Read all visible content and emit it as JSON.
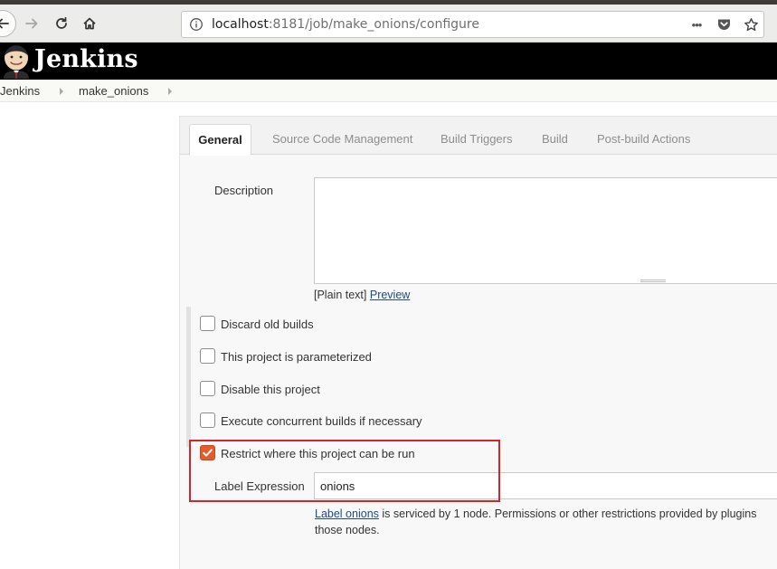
{
  "browser": {
    "url_host": "localhost",
    "url_rest": ":8181/job/make_onions/configure",
    "more_label": "•••"
  },
  "header": {
    "title": "Jenkins"
  },
  "breadcrumb": {
    "items": [
      "Jenkins",
      "make_onions"
    ]
  },
  "tabs": [
    {
      "label": "General",
      "active": true
    },
    {
      "label": "Source Code Management"
    },
    {
      "label": "Build Triggers"
    },
    {
      "label": "Build"
    },
    {
      "label": "Post-build Actions"
    }
  ],
  "description": {
    "label": "Description",
    "value": "",
    "format_note": "[Plain text]",
    "preview_link": "Preview"
  },
  "options": [
    {
      "label": "Discard old builds",
      "checked": false
    },
    {
      "label": "This project is parameterized",
      "checked": false
    },
    {
      "label": "Disable this project",
      "checked": false
    },
    {
      "label": "Execute concurrent builds if necessary",
      "checked": false
    },
    {
      "label": "Restrict where this project can be run",
      "checked": true
    }
  ],
  "label_expression": {
    "label": "Label Expression",
    "value": "onions",
    "help_link": "Label onions",
    "help_rest": " is serviced by 1 node. Permissions or other restrictions provided by plugins",
    "help_line2": "those nodes."
  },
  "colors": {
    "checkbox_checked": "#e25d2c",
    "highlight": "#d9232a",
    "link": "#204a87"
  }
}
